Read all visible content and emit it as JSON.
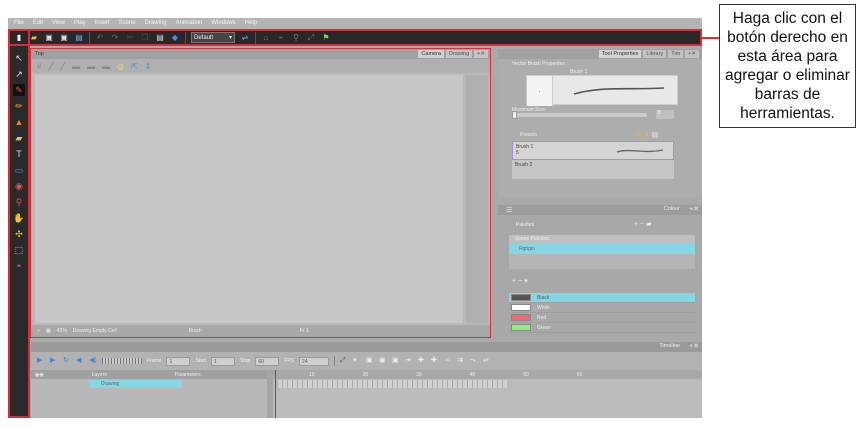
{
  "menu": [
    "File",
    "Edit",
    "View",
    "Play",
    "Insert",
    "Scene",
    "Drawing",
    "Animation",
    "Windows",
    "Help"
  ],
  "toolbar": {
    "workspace_value": "Default",
    "icons": [
      "new-scene-icon",
      "open-scene-icon",
      "save-icon",
      "save-as-icon",
      "import-icon",
      "undo-icon",
      "redo-icon",
      "cut-icon",
      "copy-icon",
      "paste-icon",
      "workspace-dropdown-icon",
      "toggle-icon",
      "camera-mode-icon",
      "deform-icon",
      "bone-icon",
      "animate-icon",
      "active-tool-icon"
    ]
  },
  "camera": {
    "tab_label": "Top",
    "tabs": [
      "Camera",
      "Drawing"
    ],
    "zoom": "43%",
    "status_label": "Drawing Empty Cell",
    "tool_label": "Brush",
    "frame_label": "Fr 1"
  },
  "tool_properties": {
    "tabs": [
      "Tool Properties",
      "Library",
      "Tim"
    ],
    "title": "Vector Brush Properties",
    "brush_name": "Brush 1",
    "max_size_label": "Maximum Size",
    "max_size_value": "5",
    "presets_label": "Presets",
    "preset_1_name": "Brush 1",
    "preset_1_size": "5",
    "preset_2_name": "Brush 2"
  },
  "colour": {
    "tab_label": "Colour",
    "palettes_label": "Palettes",
    "scene_palettes_label": "Scene Palettes",
    "palette_name": "Rgrigio",
    "swatches": [
      {
        "name": "Black",
        "color": "#555555"
      },
      {
        "name": "White",
        "color": "#ffffff"
      },
      {
        "name": "Red",
        "color": "#ee6b73"
      },
      {
        "name": "Green",
        "color": "#8bef7a"
      }
    ]
  },
  "timeline": {
    "tab_label": "Timeline",
    "frame_label": "Frame",
    "frame_value": "1",
    "start_label": "Start",
    "start_value": "1",
    "stop_label": "Stop",
    "stop_value": "60",
    "fps_label": "FPS",
    "fps_value": "24",
    "layers_label": "Layers",
    "parameters_label": "Parameters",
    "layer_name": "Drawing",
    "ruler_marks": [
      "10",
      "20",
      "30",
      "40",
      "50",
      "60"
    ]
  },
  "callout": {
    "text": "Haga clic con el botón derecho en esta área para agregar o eliminar barras de herramientas."
  },
  "colors": {
    "highlight": "#d62d3a",
    "selection": "#85d7e6"
  }
}
